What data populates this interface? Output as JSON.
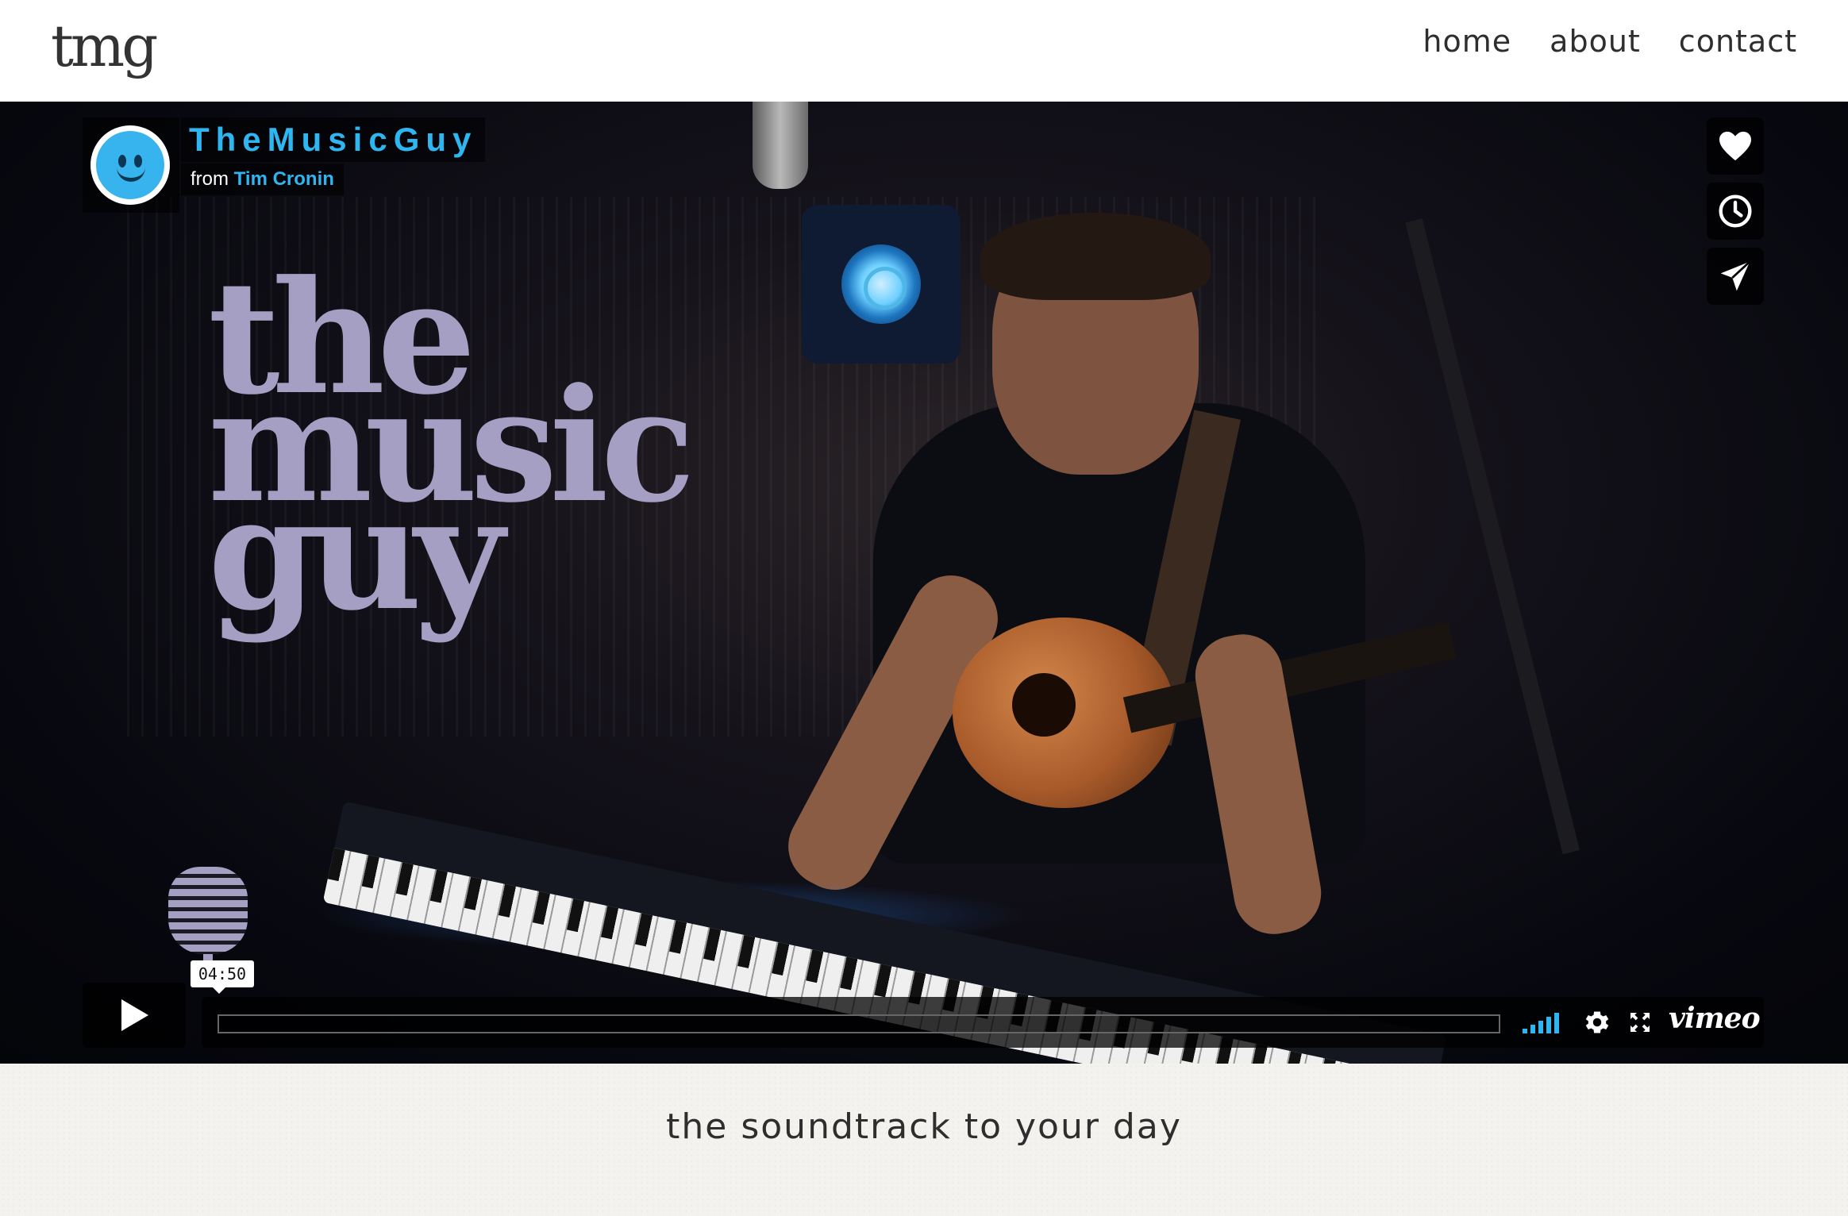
{
  "header": {
    "logo": "tmg",
    "nav": [
      {
        "label": "home"
      },
      {
        "label": "about"
      },
      {
        "label": "contact"
      }
    ]
  },
  "video": {
    "title": "TheMusicGuy",
    "byline_prefix": "from",
    "author": "Tim Cronin",
    "watermark": [
      "the",
      "music",
      "guy"
    ],
    "timestamp": "04:50",
    "progress": 0,
    "brand": "vimeo",
    "side_actions": [
      {
        "icon": "heart-icon"
      },
      {
        "icon": "clock-icon"
      },
      {
        "icon": "send-icon"
      }
    ],
    "accent_color": "#2fb5f0"
  },
  "tagline": "the soundtrack to your day"
}
